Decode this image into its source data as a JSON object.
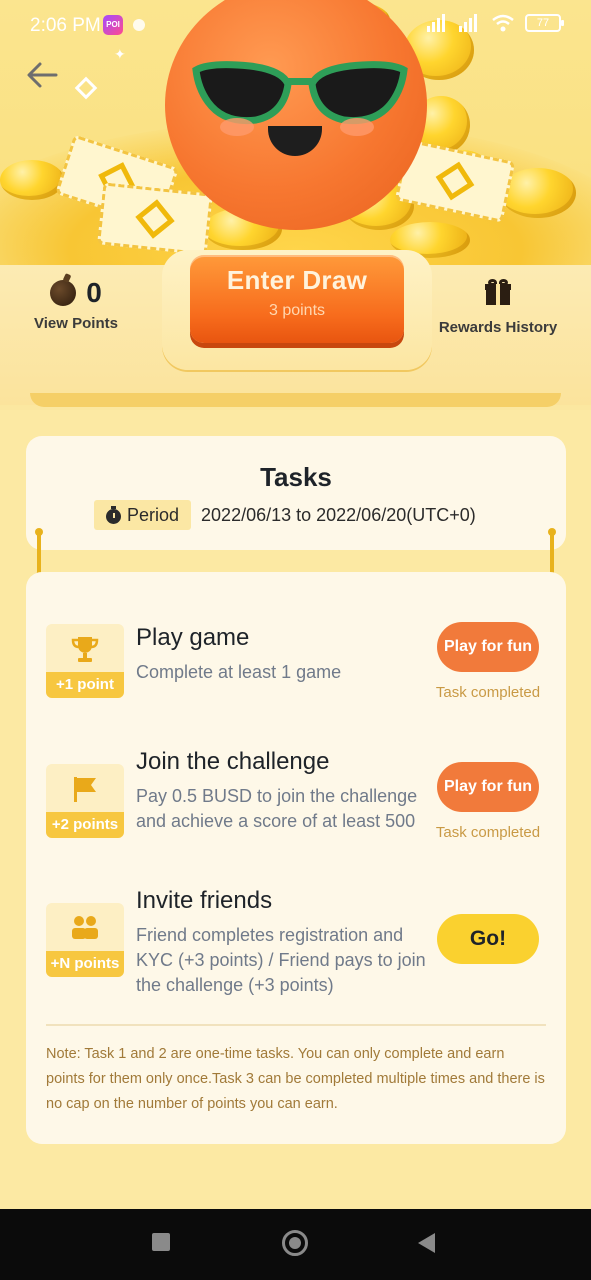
{
  "status_bar": {
    "time": "2:06 PM",
    "app_badge": "POI",
    "battery": "77"
  },
  "draw": {
    "view_points": {
      "count": "0",
      "label": "View Points"
    },
    "enter_draw": {
      "title": "Enter Draw",
      "subtitle": "3 points"
    },
    "rewards_history": {
      "label": "Rewards History"
    }
  },
  "tasks": {
    "title": "Tasks",
    "period_label": "Period",
    "period_range": "2022/06/13 to 2022/06/20(UTC+0)",
    "items": [
      {
        "icon": "trophy-icon",
        "points": "+1 point",
        "title": "Play game",
        "description": "Complete at least 1 game",
        "action_label": "Play for fun",
        "status": "Task completed"
      },
      {
        "icon": "flag-icon",
        "points": "+2 points",
        "title": "Join the challenge",
        "description": "Pay 0.5 BUSD to join the challenge and achieve a score of at least 500",
        "action_label": "Play for fun",
        "status": "Task completed"
      },
      {
        "icon": "friends-icon",
        "points": "+N points",
        "title": "Invite friends",
        "description": "Friend completes registration and KYC (+3 points) / Friend pays to join the challenge (+3 points)",
        "action_label": "Go!",
        "status": ""
      }
    ],
    "note": "Note: Task 1 and 2 are one-time tasks. You can only complete and earn points for them only once.Task 3 can be completed multiple times and there is no cap on the number of points you can earn."
  },
  "colors": {
    "background": "#FCE9A3",
    "accent_orange": "#F17A3B",
    "accent_yellow": "#FAD12F",
    "card": "#FEF8E8"
  }
}
